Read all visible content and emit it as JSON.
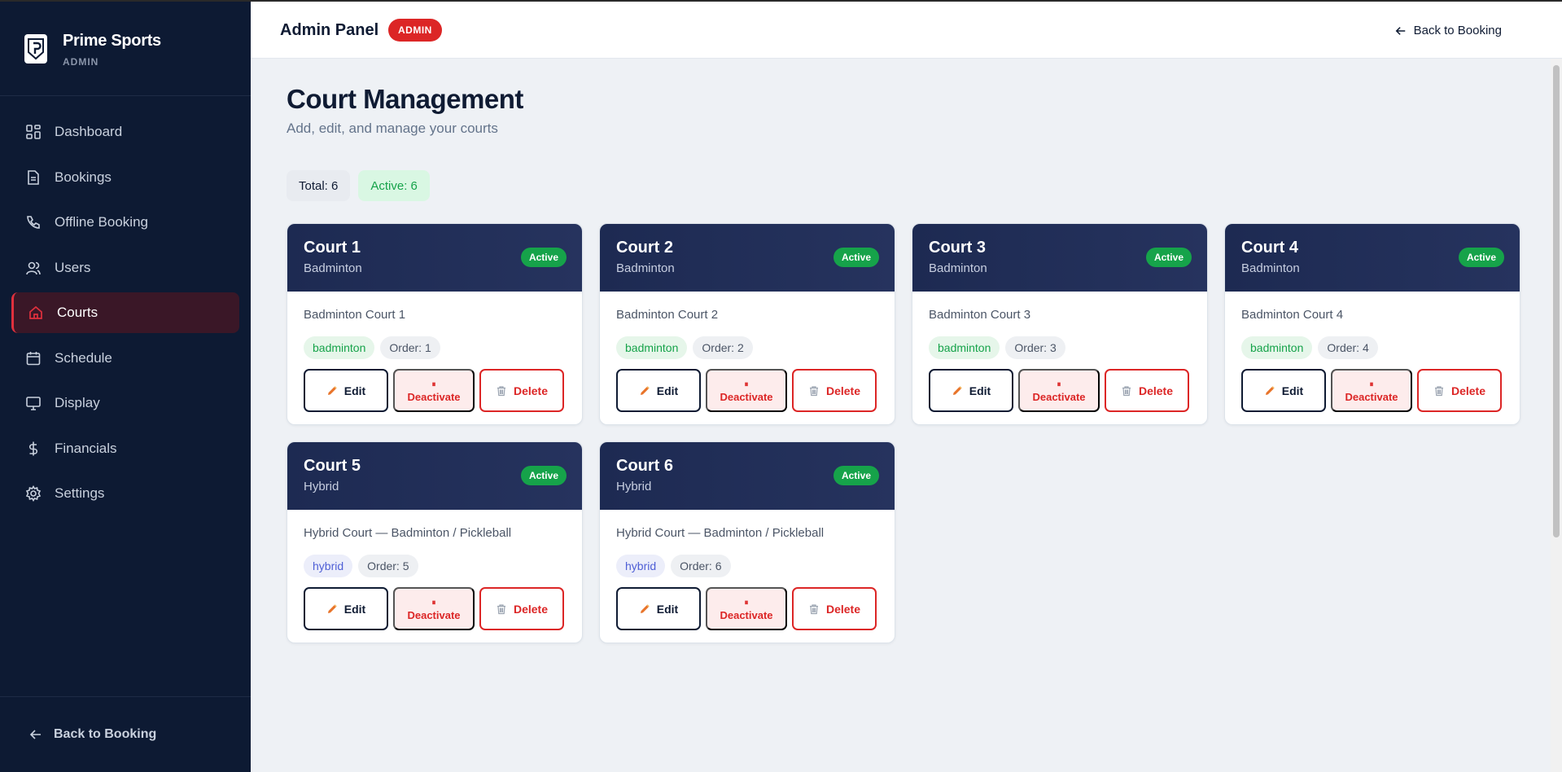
{
  "sidebar": {
    "brand_name": "Prime Sports",
    "brand_role": "ADMIN",
    "items": [
      {
        "label": "Dashboard",
        "icon": "grid-icon"
      },
      {
        "label": "Bookings",
        "icon": "document-icon"
      },
      {
        "label": "Offline Booking",
        "icon": "phone-icon"
      },
      {
        "label": "Users",
        "icon": "users-icon"
      },
      {
        "label": "Courts",
        "icon": "home-icon",
        "active": true
      },
      {
        "label": "Schedule",
        "icon": "calendar-icon"
      },
      {
        "label": "Display",
        "icon": "monitor-icon"
      },
      {
        "label": "Financials",
        "icon": "dollar-icon"
      },
      {
        "label": "Settings",
        "icon": "gear-icon"
      }
    ],
    "back_label": "Back to Booking"
  },
  "header": {
    "title": "Admin Panel",
    "badge": "ADMIN",
    "back_label": "Back to Booking"
  },
  "main": {
    "title": "Court Management",
    "subtitle": "Add, edit, and manage your courts",
    "stats": {
      "total": "Total: 6",
      "active": "Active: 6"
    },
    "courts": [
      {
        "name": "Court 1",
        "type": "Badminton",
        "status": "Active",
        "description": "Badminton Court 1",
        "sport_tag": "badminton",
        "order": "Order: 1"
      },
      {
        "name": "Court 2",
        "type": "Badminton",
        "status": "Active",
        "description": "Badminton Court 2",
        "sport_tag": "badminton",
        "order": "Order: 2"
      },
      {
        "name": "Court 3",
        "type": "Badminton",
        "status": "Active",
        "description": "Badminton Court 3",
        "sport_tag": "badminton",
        "order": "Order: 3"
      },
      {
        "name": "Court 4",
        "type": "Badminton",
        "status": "Active",
        "description": "Badminton Court 4",
        "sport_tag": "badminton",
        "order": "Order: 4"
      },
      {
        "name": "Court 5",
        "type": "Hybrid",
        "status": "Active",
        "description": "Hybrid Court — Badminton / Pickleball",
        "sport_tag": "hybrid",
        "order": "Order: 5"
      },
      {
        "name": "Court 6",
        "type": "Hybrid",
        "status": "Active",
        "description": "Hybrid Court — Badminton / Pickleball",
        "sport_tag": "hybrid",
        "order": "Order: 6"
      }
    ],
    "buttons": {
      "edit": "Edit",
      "deactivate": "Deactivate",
      "deactivate_glyph": "⏸",
      "delete": "Delete"
    }
  },
  "colors": {
    "sidebar_bg": "#0d1a33",
    "accent_red": "#dc2626",
    "active_green": "#16a34a",
    "card_header": "#1d2a52"
  }
}
